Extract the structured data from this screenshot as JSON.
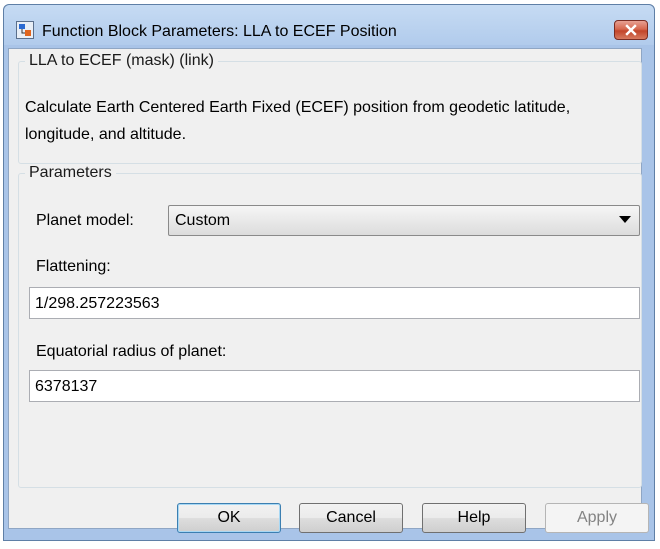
{
  "window": {
    "title": "Function Block Parameters: LLA to ECEF Position",
    "close_icon": "close-x-icon",
    "app_icon": "simulink-block-icon"
  },
  "mask_group": {
    "legend": "LLA to ECEF (mask) (link)",
    "description": "Calculate Earth Centered Earth Fixed (ECEF) position from geodetic latitude, longitude, and altitude."
  },
  "parameters_group": {
    "legend": "Parameters",
    "planet_model": {
      "label": "Planet model:",
      "value": "Custom"
    },
    "flattening": {
      "label": "Flattening:",
      "value": "1/298.257223563"
    },
    "equatorial_radius": {
      "label": "Equatorial radius of planet:",
      "value": "6378137"
    }
  },
  "buttons": {
    "ok": "OK",
    "cancel": "Cancel",
    "help": "Help",
    "apply": "Apply"
  },
  "colors": {
    "window_frame": "#a9c4e8",
    "close_button": "#c8452b",
    "dialog_background": "#f0f0f0"
  }
}
